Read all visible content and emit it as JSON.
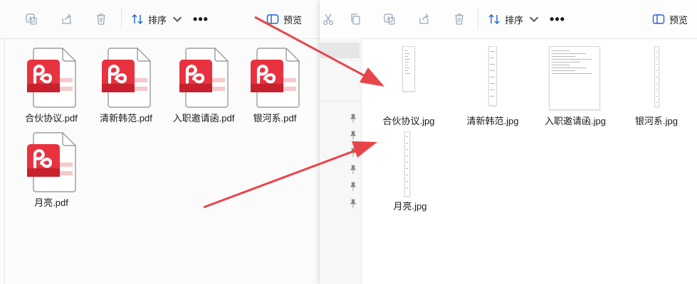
{
  "left_window": {
    "toolbar": {
      "sort_label": "排序",
      "more_label": "•••",
      "preview_label": "预览"
    },
    "files": [
      {
        "name": "合伙协议.pdf"
      },
      {
        "name": "清新韩范.pdf"
      },
      {
        "name": "入职邀请函.pdf"
      },
      {
        "name": "银河系.pdf"
      },
      {
        "name": "月亮.pdf"
      }
    ]
  },
  "right_window": {
    "toolbar": {
      "sort_label": "排序",
      "more_label": "•••",
      "preview_label": "预览"
    },
    "files": [
      {
        "name": "合伙协议.jpg"
      },
      {
        "name": "清新韩范.jpg"
      },
      {
        "name": "入职邀请函.jpg"
      },
      {
        "name": "银河系.jpg"
      },
      {
        "name": "月亮.jpg"
      }
    ]
  },
  "colors": {
    "pdf_red": "#e8323f",
    "arrow_red": "#e8454a",
    "accent_blue": "#1a62d6"
  },
  "icons": [
    "scissors-icon",
    "copy-icon",
    "rename-icon",
    "share-icon",
    "delete-icon",
    "sort-icon",
    "preview-icon",
    "pin-icon",
    "pdf-file-icon"
  ]
}
